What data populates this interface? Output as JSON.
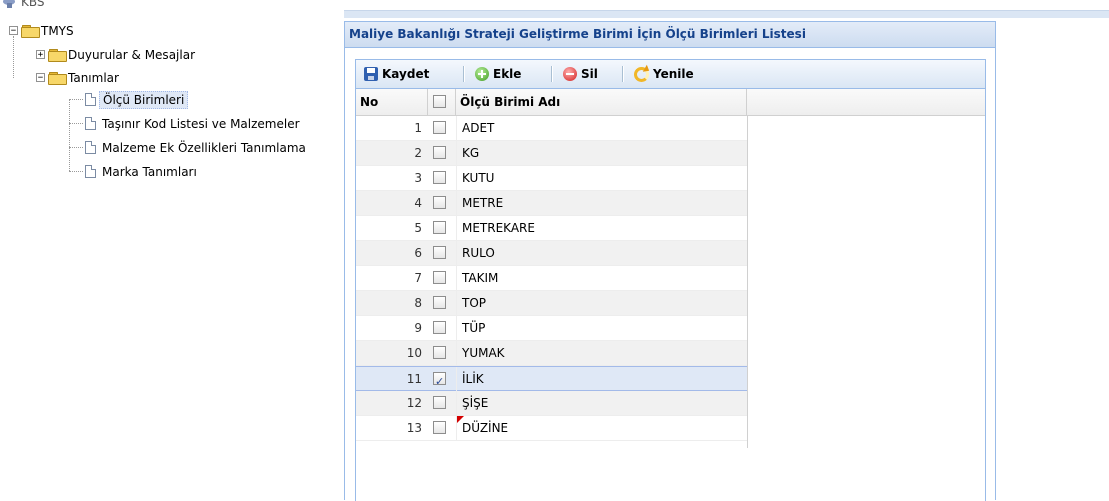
{
  "tree": {
    "root": "KBS",
    "module": "TMYS",
    "nodes": {
      "duyurular": "Duyurular & Mesajlar",
      "tanimlar": "Tanımlar",
      "olcu_birimleri": "Ölçü Birimleri",
      "tasinir_kod": "Taşınır Kod Listesi ve Malzemeler",
      "malzeme_ek": "Malzeme Ek Özellikleri Tanımlama",
      "marka": "Marka Tanımları"
    }
  },
  "panel": {
    "title": "Maliye Bakanlığı Strateji Geliştirme Birimi İçin Ölçü Birimleri Listesi"
  },
  "toolbar": {
    "save_label": "Kaydet",
    "add_label": "Ekle",
    "delete_label": "Sil",
    "refresh_label": "Yenile"
  },
  "grid": {
    "columns": {
      "no": "No",
      "name": "Ölçü Birimi Adı"
    },
    "rows": [
      {
        "no": "1",
        "name": "ADET",
        "checked": false
      },
      {
        "no": "2",
        "name": "KG",
        "checked": false
      },
      {
        "no": "3",
        "name": "KUTU",
        "checked": false
      },
      {
        "no": "4",
        "name": "METRE",
        "checked": false
      },
      {
        "no": "5",
        "name": "METREKARE",
        "checked": false
      },
      {
        "no": "6",
        "name": "RULO",
        "checked": false
      },
      {
        "no": "7",
        "name": "TAKIM",
        "checked": false
      },
      {
        "no": "8",
        "name": "TOP",
        "checked": false
      },
      {
        "no": "9",
        "name": "TÜP",
        "checked": false
      },
      {
        "no": "10",
        "name": "YUMAK",
        "checked": false
      },
      {
        "no": "11",
        "name": "İLİK",
        "checked": true,
        "selected": true
      },
      {
        "no": "12",
        "name": "ŞİŞE",
        "checked": false
      },
      {
        "no": "13",
        "name": "DÜZİNE",
        "checked": false,
        "dirty": true
      }
    ]
  },
  "colors": {
    "panel_border": "#99bbe8",
    "header_text": "#15428b",
    "selected_row": "#dfe8f6",
    "dirty_marker": "#d40000"
  }
}
